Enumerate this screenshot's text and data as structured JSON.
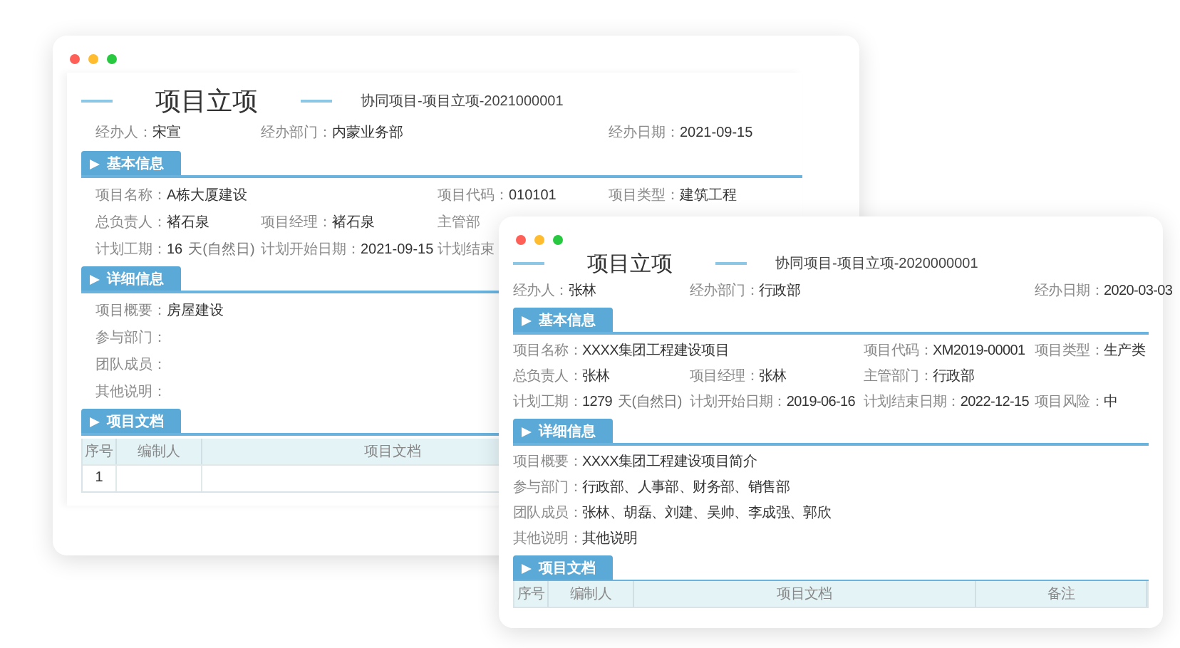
{
  "windows": [
    {
      "title": "项目立项",
      "code": "协同项目-项目立项-2021000001",
      "meta": [
        {
          "label": "经办人：",
          "value": "宋宣"
        },
        {
          "label": "经办部门：",
          "value": "内蒙业务部"
        },
        {
          "label": "经办日期：",
          "value": "2021-09-15"
        }
      ],
      "sections": [
        {
          "kind": "grid",
          "title": "基本信息",
          "rows": [
            [
              {
                "label": "项目名称：",
                "value": "A栋大厦建设"
              },
              "",
              {
                "label": "项目代码：",
                "value": "010101"
              },
              {
                "label": "项目类型：",
                "value": "建筑工程"
              }
            ],
            [
              {
                "label": "总负责人：",
                "value": "褚石泉"
              },
              {
                "label": "项目经理：",
                "value": "褚石泉"
              },
              {
                "label": "主管部"
              }
            ],
            [
              {
                "label": "计划工期：",
                "value": "16",
                "unit": "天(自然日)"
              },
              {
                "label": "计划开始日期：",
                "value": "2021-09-15"
              },
              {
                "label": "计划结束"
              }
            ]
          ]
        },
        {
          "kind": "list",
          "title": "详细信息",
          "rows": [
            {
              "label": "项目概要：",
              "value": "房屋建设"
            },
            {
              "label": "参与部门："
            },
            {
              "label": "团队成员："
            },
            {
              "label": "其他说明："
            }
          ]
        },
        {
          "kind": "table",
          "title": "项目文档",
          "columns": [
            "序号",
            "编制人",
            "项目文档"
          ],
          "rows": [
            [
              "1"
            ]
          ]
        }
      ]
    },
    {
      "title": "项目立项",
      "code": "协同项目-项目立项-2020000001",
      "meta": [
        {
          "label": "经办人：",
          "value": "张林"
        },
        {
          "label": "经办部门：",
          "value": "行政部"
        },
        {
          "label": "经办日期：",
          "value": "2020-03-03"
        }
      ],
      "sections": [
        {
          "kind": "grid",
          "title": "基本信息",
          "rows": [
            [
              {
                "label": "项目名称：",
                "value": "XXXX集团工程建设项目"
              },
              "",
              {
                "label": "项目代码：",
                "value": "XM2019-00001"
              },
              {
                "label": "项目类型：",
                "value": "生产类"
              }
            ],
            [
              {
                "label": "总负责人：",
                "value": "张林"
              },
              {
                "label": "项目经理：",
                "value": "张林"
              },
              {
                "label": "主管部门：",
                "value": "行政部"
              }
            ],
            [
              {
                "label": "计划工期：",
                "value": "1279",
                "unit": "天(自然日)"
              },
              {
                "label": "计划开始日期：",
                "value": "2019-06-16"
              },
              {
                "label": "计划结束日期：",
                "value": "2022-12-15"
              },
              {
                "label": "项目风险：",
                "value": "中"
              }
            ]
          ]
        },
        {
          "kind": "list",
          "title": "详细信息",
          "rows": [
            {
              "label": "项目概要：",
              "value": "XXXX集团工程建设项目简介"
            },
            {
              "label": "参与部门：",
              "value": "行政部、人事部、财务部、销售部"
            },
            {
              "label": "团队成员：",
              "value": "张林、胡磊、刘建、吴帅、李成强、郭欣"
            },
            {
              "label": "其他说明：",
              "value": "其他说明"
            }
          ]
        },
        {
          "kind": "table",
          "title": "项目文档",
          "columns": [
            "序号",
            "编制人",
            "项目文档",
            "备注"
          ]
        }
      ]
    }
  ]
}
